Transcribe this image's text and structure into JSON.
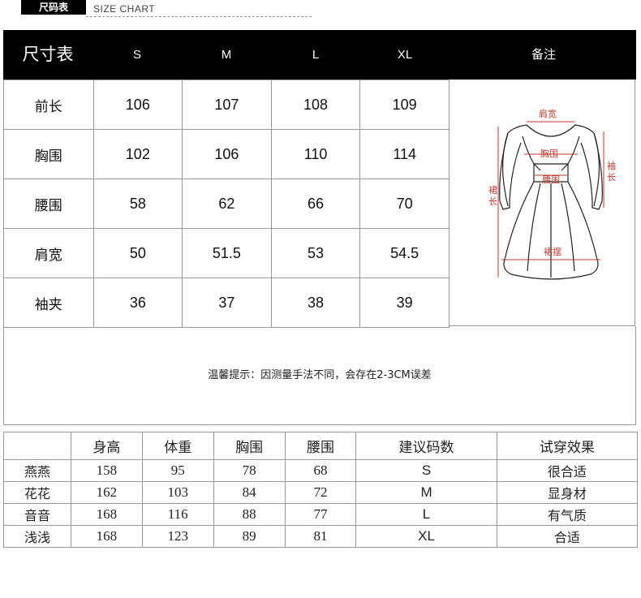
{
  "header": {
    "tag": "尺码表",
    "subtitle": "SIZE CHART"
  },
  "size_table": {
    "title": "尺寸表",
    "sizes": [
      "S",
      "M",
      "L",
      "XL"
    ],
    "note_header": "备注",
    "rows": [
      {
        "label": "前长",
        "values": [
          "106",
          "107",
          "108",
          "109"
        ]
      },
      {
        "label": "胸围",
        "values": [
          "102",
          "106",
          "110",
          "114"
        ]
      },
      {
        "label": "腰围",
        "values": [
          "58",
          "62",
          "66",
          "70"
        ]
      },
      {
        "label": "肩宽",
        "values": [
          "50",
          "51.5",
          "53",
          "54.5"
        ]
      },
      {
        "label": "袖夹",
        "values": [
          "36",
          "37",
          "38",
          "39"
        ]
      }
    ]
  },
  "illustration": {
    "labels": {
      "shoulder": "肩宽",
      "chest": "胸围",
      "waist": "腰围",
      "sleeve": "袖长",
      "length": "裙长",
      "hem": "裙摆"
    },
    "accent_color": "#c0392b"
  },
  "notice": "温馨提示：因测量手法不同，会存在2-3CM误差",
  "reference_table": {
    "headers": [
      "",
      "身高",
      "体重",
      "胸围",
      "腰围",
      "建议码数",
      "试穿效果"
    ],
    "rows": [
      [
        "燕燕",
        "158",
        "95",
        "78",
        "68",
        "S",
        "很合适"
      ],
      [
        "花花",
        "162",
        "103",
        "84",
        "72",
        "M",
        "显身材"
      ],
      [
        "音音",
        "168",
        "116",
        "88",
        "77",
        "L",
        "有气质"
      ],
      [
        "浅浅",
        "168",
        "123",
        "89",
        "81",
        "XL",
        "合适"
      ]
    ]
  }
}
